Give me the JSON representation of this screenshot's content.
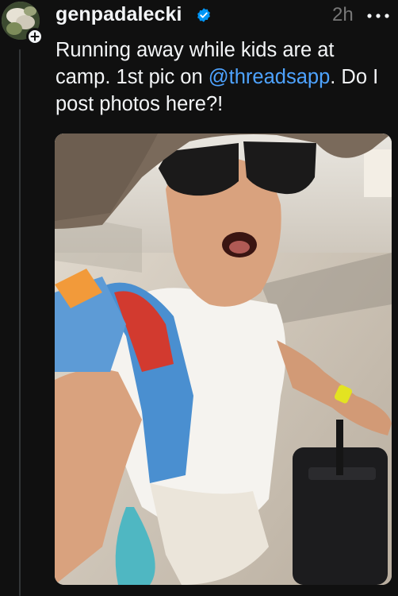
{
  "post": {
    "username": "genpadalecki",
    "verified": true,
    "time": "2h",
    "text_before": "Running away while kids are at camp. 1st pic on ",
    "mention": "@threadsapp",
    "text_after": ". Do I post photos here?!"
  },
  "icons": {
    "avatar": "avatar",
    "follow": "plus-icon",
    "verified": "verified-badge-icon",
    "more": "more-horizontal-icon"
  },
  "colors": {
    "background": "#101010",
    "text": "#f3f5f7",
    "muted": "#777777",
    "mention": "#4ea3ff",
    "verified": "#0095f6"
  }
}
